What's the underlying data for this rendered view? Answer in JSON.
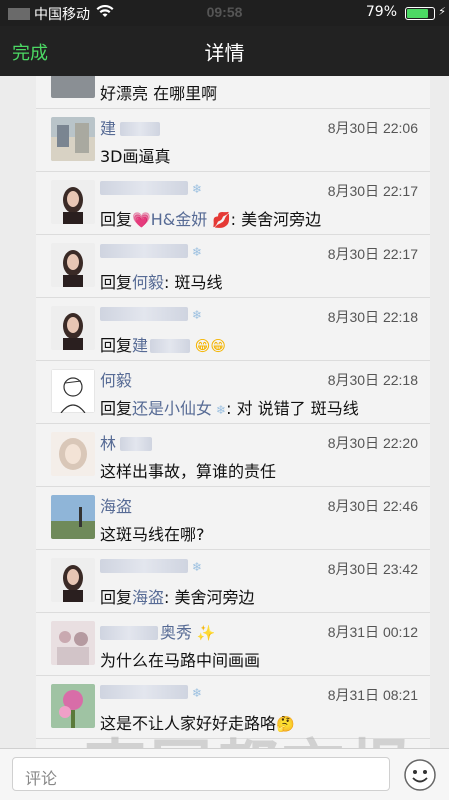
{
  "status_bar": {
    "carrier": "中国移动",
    "time": "09:58",
    "battery_percent": "79%",
    "battery_level": 0.79
  },
  "nav": {
    "done_label": "完成",
    "title": "详情"
  },
  "comments": [
    {
      "name": "",
      "time": "",
      "text": "好漂亮 在哪里啊"
    },
    {
      "name": "建",
      "time": "8月30日 22:06",
      "text": "3D画逼真"
    },
    {
      "name": "",
      "time": "8月30日 22:17",
      "reply_prefix": "回复",
      "reply_to": "H&金妍",
      "text": ": 美舍河旁边"
    },
    {
      "name": "",
      "time": "8月30日 22:17",
      "reply_prefix": "回复",
      "reply_to": "何毅",
      "text": ": 斑马线"
    },
    {
      "name": "",
      "time": "8月30日 22:18",
      "reply_prefix": "回复",
      "reply_to": "建"
    },
    {
      "name": "何毅",
      "time": "8月30日 22:18",
      "reply_prefix": "回复",
      "reply_to": "还是小仙女",
      "text": ": 对 说错了 斑马线"
    },
    {
      "name": "林",
      "time": "8月30日 22:20",
      "text": "这样出事故，算谁的责任"
    },
    {
      "name": "海盗",
      "time": "8月30日 22:46",
      "text": "这斑马线在哪?"
    },
    {
      "name": "",
      "time": "8月30日 23:42",
      "reply_prefix": "回复",
      "reply_to": "海盗",
      "text": ": 美舍河旁边"
    },
    {
      "name": "奥秀",
      "time": "8月31日 00:12",
      "text": "为什么在马路中间画画"
    },
    {
      "name": "",
      "time": "8月31日 08:21",
      "text": "这是不让人家好好走路咯"
    }
  ],
  "input": {
    "placeholder": "评论"
  },
  "watermark": "南国都市报",
  "icons": {
    "wifi": "wifi-icon",
    "battery": "battery-icon",
    "emoji": "smiley-icon",
    "heart": "heart-emoji",
    "lips": "lips-emoji",
    "grin": "grin-emoji",
    "sparkles": "sparkles-emoji",
    "think": "thinking-emoji"
  },
  "colors": {
    "accent": "#4cd964",
    "link": "#576b95"
  }
}
